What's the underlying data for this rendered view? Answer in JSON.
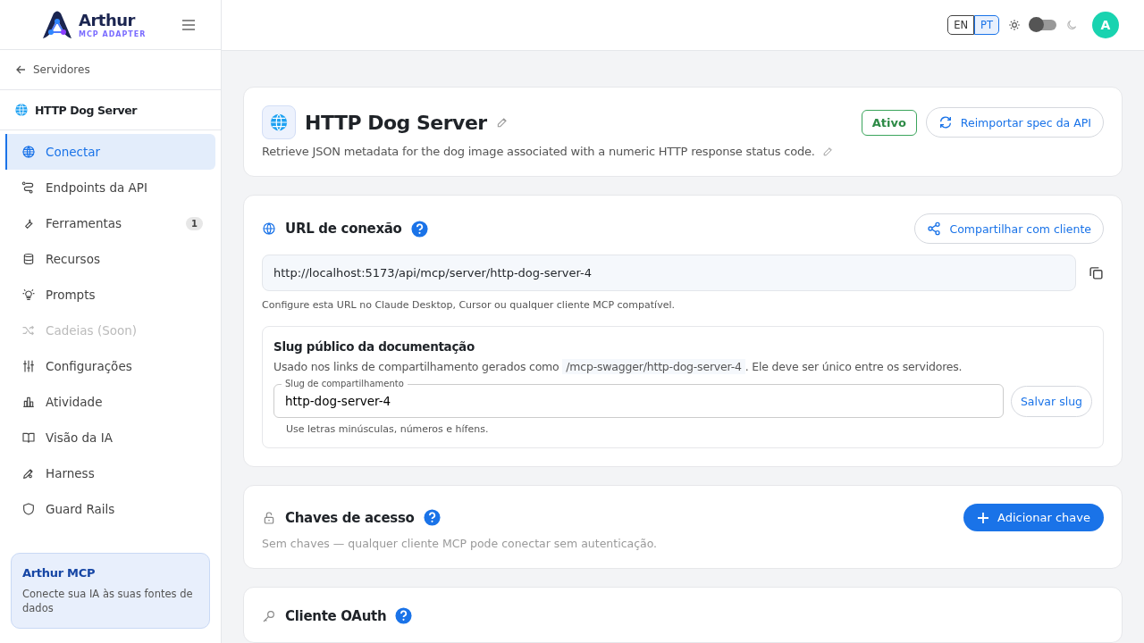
{
  "logo": {
    "name": "Arthur",
    "tagline": "MCP ADAPTER"
  },
  "topbar": {
    "languages": [
      {
        "label": "EN",
        "selected": false
      },
      {
        "label": "PT",
        "selected": true
      }
    ],
    "dark_mode": false,
    "avatar": "A"
  },
  "sidebar": {
    "back": "Servidores",
    "server": "HTTP Dog Server",
    "items": [
      {
        "label": "Conectar",
        "selected": true,
        "disabled": false
      },
      {
        "label": "Endpoints da API",
        "selected": false,
        "disabled": false
      },
      {
        "label": "Ferramentas",
        "selected": false,
        "disabled": false,
        "badge": "1"
      },
      {
        "label": "Recursos",
        "selected": false,
        "disabled": false
      },
      {
        "label": "Prompts",
        "selected": false,
        "disabled": false
      },
      {
        "label": "Cadeias (Soon)",
        "selected": false,
        "disabled": true
      },
      {
        "label": "Configurações",
        "selected": false,
        "disabled": false
      },
      {
        "label": "Atividade",
        "selected": false,
        "disabled": false
      },
      {
        "label": "Visão da IA",
        "selected": false,
        "disabled": false
      },
      {
        "label": "Harness",
        "selected": false,
        "disabled": false
      },
      {
        "label": "Guard Rails",
        "selected": false,
        "disabled": false
      }
    ],
    "promo": {
      "title": "Arthur MCP",
      "text": "Conecte sua IA às suas fontes de dados"
    }
  },
  "header": {
    "title": "HTTP Dog Server",
    "description": "Retrieve JSON metadata for the dog image associated with a numeric HTTP response status code.",
    "status": "Ativo",
    "reimport": "Reimportar spec da API"
  },
  "connection": {
    "title": "URL de conexão",
    "share": "Compartilhar com cliente",
    "url": "http://localhost:5173/api/mcp/server/http-dog-server-4",
    "hint": "Configure esta URL no Claude Desktop, Cursor ou qualquer cliente MCP compatível.",
    "slug": {
      "title": "Slug público da documentação",
      "text_before": "Usado nos links de compartilhamento gerados como",
      "code": "/mcp-swagger/http-dog-server-4",
      "text_after": ". Ele deve ser único entre os servidores.",
      "field_label": "Slug de compartilhamento",
      "value": "http-dog-server-4",
      "save": "Salvar slug",
      "help": "Use letras minúsculas, números e hífens."
    }
  },
  "keys": {
    "title": "Chaves de acesso",
    "text": "Sem chaves — qualquer cliente MCP pode conectar sem autenticação.",
    "add": "Adicionar chave"
  },
  "oauth": {
    "title": "Cliente OAuth"
  }
}
